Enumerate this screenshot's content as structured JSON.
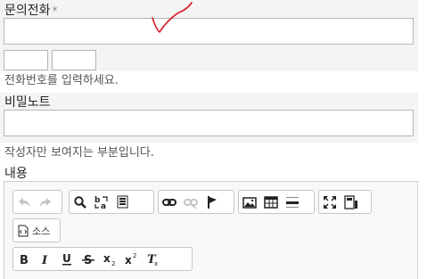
{
  "form": {
    "phone": {
      "label": "문의전화",
      "required_mark": "*",
      "hint": "전화번호를 입력하세요."
    },
    "secret_note": {
      "label": "비밀노트",
      "hint": "작성자만 보여지는 부분입니다."
    },
    "content": {
      "label": "내용"
    }
  },
  "editor_toolbar": {
    "row1": [
      {
        "group": "history",
        "buttons": [
          "undo-icon",
          "redo-icon"
        ]
      },
      {
        "group": "find",
        "buttons": [
          "find-icon",
          "replace-icon",
          "select-all-icon"
        ]
      },
      {
        "group": "links",
        "buttons": [
          "link-icon",
          "unlink-icon",
          "anchor-flag-icon"
        ]
      },
      {
        "group": "insert",
        "buttons": [
          "image-icon",
          "table-icon",
          "horizontal-rule-icon"
        ]
      },
      {
        "group": "view",
        "buttons": [
          "maximize-icon",
          "show-blocks-icon"
        ]
      }
    ],
    "source_button_label": "소스",
    "row3": [
      {
        "group": "basicstyles",
        "buttons": [
          "bold-icon",
          "italic-icon",
          "underline-icon",
          "strike-icon",
          "subscript-icon",
          "superscript-icon",
          "remove-format-icon"
        ]
      }
    ]
  },
  "colors": {
    "checkmark": "#d7191f",
    "band_bg": "#f4f4f4",
    "input_border": "#b5b5b5"
  }
}
